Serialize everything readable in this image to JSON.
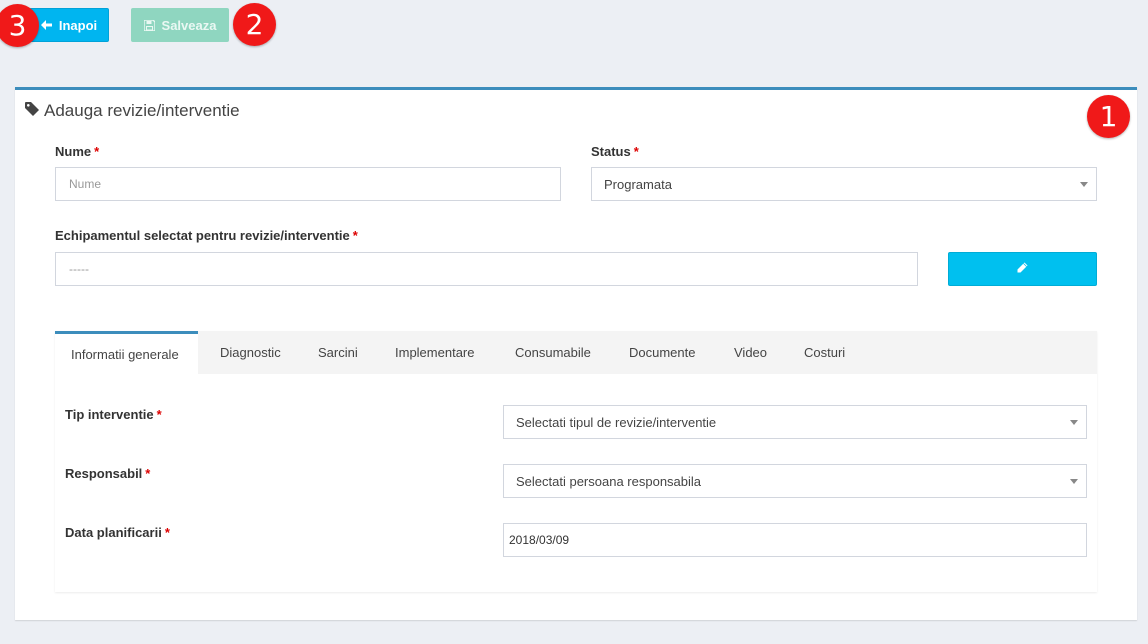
{
  "toolbar": {
    "back_label": "Inapoi",
    "save_label": "Salveaza"
  },
  "markers": {
    "one": "1",
    "two": "2",
    "three": "3"
  },
  "panel": {
    "title": "Adauga revizie/interventie"
  },
  "form": {
    "required_mark": "*",
    "name": {
      "label": "Nume",
      "placeholder": "Nume",
      "value": ""
    },
    "status": {
      "label": "Status",
      "value": "Programata"
    },
    "equipment": {
      "label": "Echipamentul selectat pentru revizie/interventie",
      "value": "-----"
    }
  },
  "tabs": [
    {
      "label": "Informatii generale",
      "active": true
    },
    {
      "label": "Diagnostic"
    },
    {
      "label": "Sarcini"
    },
    {
      "label": "Implementare"
    },
    {
      "label": "Consumabile"
    },
    {
      "label": "Documente"
    },
    {
      "label": "Video"
    },
    {
      "label": "Costuri"
    }
  ],
  "general": {
    "type": {
      "label": "Tip interventie",
      "value": "Selectati tipul de revizie/interventie"
    },
    "responsible": {
      "label": "Responsabil",
      "value": "Selectati persoana responsabila"
    },
    "planned_date": {
      "label": "Data planificarii",
      "value": "2018/03/09"
    }
  },
  "colors": {
    "accent": "#3c8dbc",
    "info": "#00c0ef",
    "marker": "#f01919",
    "required": "#dd0000"
  },
  "icons": {
    "back": "arrow-left-icon",
    "save": "floppy-disk-icon",
    "tag": "tag-icon",
    "edit": "pencil-icon"
  }
}
